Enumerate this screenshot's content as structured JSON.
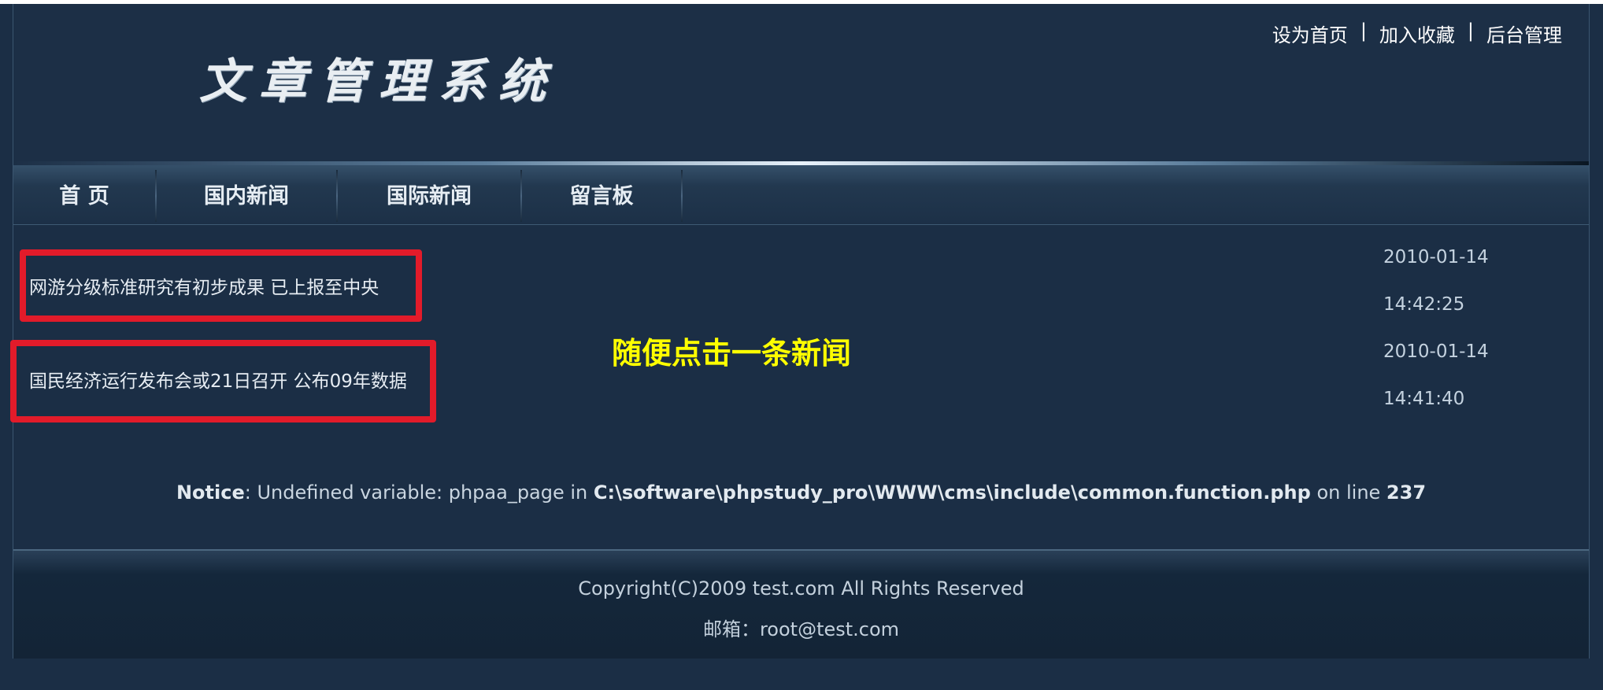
{
  "header": {
    "logo_text": "文章管理系统",
    "links": [
      "设为首页",
      "加入收藏",
      "后台管理"
    ],
    "separator": "|"
  },
  "nav": {
    "items": [
      "首 页",
      "国内新闻",
      "国际新闻",
      "留言板"
    ]
  },
  "news": [
    {
      "title": "网游分级标准研究有初步成果 已上报至中央",
      "date": "2010-01-14",
      "time": "14:42:25"
    },
    {
      "title": "国民经济运行发布会或21日召开 公布09年数据",
      "date": "2010-01-14",
      "time": "14:41:40"
    }
  ],
  "annotation": {
    "hint_text": "随便点击一条新闻",
    "highlight_color": "#e21b2a",
    "hint_color": "#ffff00"
  },
  "notice": {
    "label": "Notice",
    "message_pre": ": Undefined variable: phpaa_page in ",
    "file": "C:\\software\\phpstudy_pro\\WWW\\cms\\include\\common.function.php",
    "message_mid": " on line ",
    "line": "237"
  },
  "footer": {
    "copyright": "Copyright(C)2009 test.com All Rights Reserved",
    "email": "邮箱：root@test.com"
  }
}
